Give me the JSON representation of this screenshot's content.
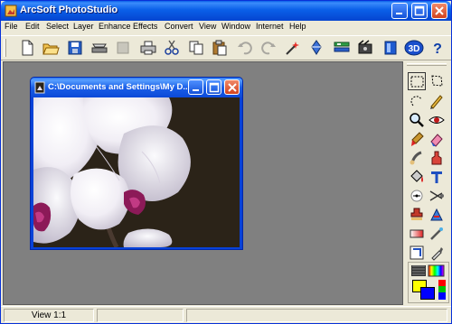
{
  "app": {
    "title": "ArcSoft PhotoStudio"
  },
  "menu": [
    "File",
    "Edit",
    "Select",
    "Layer",
    "Enhance",
    "Effects",
    "Convert",
    "View",
    "Window",
    "Internet",
    "Help"
  ],
  "toolbar": {
    "buttons": [
      "new-icon",
      "open-icon",
      "save-icon",
      "scanner-icon",
      "disabled-icon",
      "print-icon",
      "cut-icon",
      "copy-icon",
      "paste-icon",
      "undo-icon",
      "redo-icon",
      "magic-wand-icon",
      "effects-icon",
      "layers-icon",
      "slideshow-icon",
      "album-icon",
      "3d-icon",
      "help-icon"
    ],
    "label_3d": "3D",
    "label_help": "?"
  },
  "document": {
    "title": "C:\\Documents and Settings\\My D..."
  },
  "tools": [
    "marquee-select-icon",
    "lasso-select-icon",
    "magic-wand-select-icon",
    "pencil-icon",
    "zoom-icon",
    "red-eye-icon",
    "brush-icon",
    "eraser-icon",
    "smudge-icon",
    "clone-icon",
    "paint-bucket-icon",
    "text-icon",
    "line-icon",
    "scissors-icon",
    "stamp-icon",
    "mosaic-icon",
    "gradient-icon",
    "blur-icon",
    "crop-icon",
    "eyedropper-icon",
    "rotate-icon",
    "trash-icon"
  ],
  "colors": {
    "foreground": "#ffff00",
    "background": "#0000ff",
    "accent": "#0a5fe8"
  },
  "status": {
    "zoom": "View 1:1"
  }
}
